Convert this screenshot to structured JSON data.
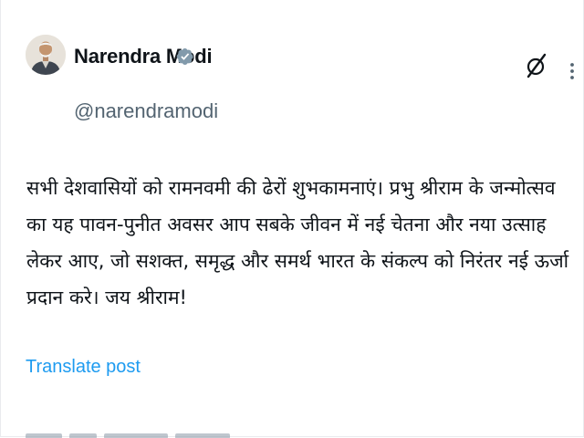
{
  "post": {
    "author": {
      "name": "Narendra Modi",
      "handle": "@narendramodi",
      "verified_icon": "verified-badge-icon",
      "verified_color": "#829aab"
    },
    "actions": {
      "grok_icon": "grok-icon",
      "more_icon": "more-options-icon"
    },
    "text": "सभी देशवासियों को रामनवमी की ढेरों शुभकामनाएं। प्रभु श्रीराम के जन्मोत्सव का यह पावन-पुनीत अवसर आप सबके जीवन में नई चेतना और नया उत्साह लेकर आए, जो सशक्त, समृद्ध और समर्थ भारत के संकल्प को निरंतर नई ऊर्जा प्रदान करे। जय श्रीराम!",
    "translate_label": "Translate post",
    "link_color": "#1d9bf0"
  }
}
